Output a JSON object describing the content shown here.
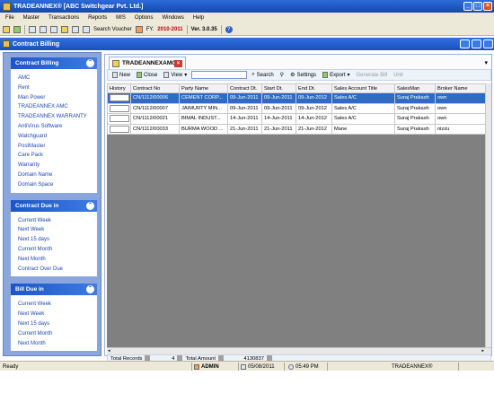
{
  "window": {
    "title": "TRADEANNEX® [ABC Switchgear Pvt. Ltd.]",
    "buttons": [
      "_",
      "□",
      "×"
    ]
  },
  "menu": [
    "File",
    "Master",
    "Transactions",
    "Reports",
    "MIS",
    "Options",
    "Windows",
    "Help"
  ],
  "toolbar": {
    "search_voucher": "Search Voucher",
    "fy_label": "FY.",
    "fy_value": "2010-2011",
    "version": "Ver. 3.0.35",
    "help": "?"
  },
  "child_window": {
    "title": "Contract Billing"
  },
  "sidebar": {
    "panels": [
      {
        "title": "Contract Billing",
        "items": [
          "AMC",
          "Rent",
          "Man Power",
          "TRADEANNEX AMC",
          "TRADEANNEX WARRANTY",
          "AntiVirus Software",
          "Watchguard",
          "PostMaster",
          "Care Pack",
          "Warranty",
          "Domain Name",
          "Domain Space"
        ]
      },
      {
        "title": "Contract Due in",
        "items": [
          "Current Week",
          "Next Week",
          "Next 15 days",
          "Current Month",
          "Next Month",
          "Contract Over Due"
        ]
      },
      {
        "title": "Bill Due in",
        "items": [
          "Current Week",
          "Next Week",
          "Next 15 days",
          "Current Month",
          "Next Month"
        ]
      }
    ]
  },
  "tab": {
    "label": "TRADEANNEXAMC"
  },
  "inner_toolbar": {
    "new": "New",
    "close": "Close",
    "view": "View",
    "search": "Search",
    "settings": "Settings",
    "export": "Export",
    "generate_bill": "Generate Bill",
    "unit": "Unit"
  },
  "table": {
    "columns": [
      "History",
      "Contract No",
      "Party Name",
      "Contract Dt.",
      "Start Dt.",
      "End Dt.",
      "Sales Account Title",
      "SalesMan",
      "Broker Name"
    ],
    "rows": [
      [
        "",
        "CN/1112/00006",
        "CEMENT CORP...",
        "09-Jun-2011",
        "09-Jun-2011",
        "09-Jun-2012",
        "Sales A/C",
        "Suraj Prakash",
        "own"
      ],
      [
        "",
        "CN/1112/00007",
        "JAIMURTY MIN...",
        "09-Jun-2011",
        "09-Jun-2011",
        "09-Jun-2012",
        "Sales A/C",
        "Suraj Prakash",
        "own"
      ],
      [
        "",
        "CN/1112/00021",
        "BIMAL INDUST...",
        "14-Jun-2011",
        "14-Jun-2011",
        "14-Jun-2012",
        "Sales A/C",
        "Suraj Prakash",
        "own"
      ],
      [
        "",
        "CN/1112/00033",
        "BURMA WOOD ...",
        "21-Jun-2011",
        "21-Jun-2011",
        "21-Jun-2012",
        "Mane",
        "Suraj Prakash",
        "nizzu"
      ]
    ],
    "selected_row": 0
  },
  "footer": {
    "total_records_label": "Total Records",
    "total_records": "4",
    "total_amount_label": "Total Amount",
    "total_amount": "4130837"
  },
  "status": {
    "ready": "Ready",
    "user": "ADMIN",
    "date": "05/08/2011",
    "time": "05:49 PM",
    "app": "TRADEANNEX®"
  }
}
